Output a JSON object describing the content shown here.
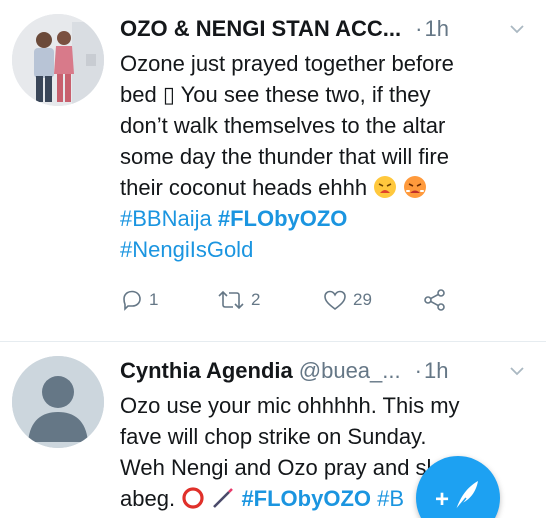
{
  "tweets": [
    {
      "author_name": "OZO & NENGI STAN ACC...",
      "dot": "·",
      "time": "1h",
      "text_line1": "Ozone just prayed together before",
      "text_line2": "bed ▯ You see these two, if they",
      "text_line3": "don’t walk themselves to the altar",
      "text_line4": "some day the thunder that will fire",
      "text_line5": "their coconut heads ehhh",
      "hashtag1": "#BBNaija",
      "hashtag2": "#FLObyOZO",
      "hashtag3": "#NengiIsGold",
      "replies": "1",
      "retweets": "2",
      "likes": "29"
    },
    {
      "author_name": "Cynthia Agendia",
      "handle": "@buea_...",
      "dot": "·",
      "time": "1h",
      "text_line1": "Ozo use your mic ohhhhh. This my",
      "text_line2": "fave will chop strike on Sunday.",
      "text_line3": "Weh Nengi and Ozo pray and sleep",
      "text_line4_start": "abeg.",
      "hashtag1": "#FLObyOZO",
      "hashtag2_partial": "#B"
    }
  ],
  "icons": {
    "caret": "chevron-down-icon",
    "reply": "reply-icon",
    "retweet": "retweet-icon",
    "like": "heart-icon",
    "share": "share-icon",
    "compose": "compose-feather-icon",
    "emoji_tired": "tired-face-emoji",
    "emoji_angry": "steaming-face-emoji",
    "emoji_circle": "red-circle-emoji",
    "emoji_wand": "magic-wand-emoji"
  },
  "colors": {
    "link": "#1b95e0",
    "muted": "#657786",
    "fab": "#1da1f2",
    "divider": "#e6ecf0"
  }
}
